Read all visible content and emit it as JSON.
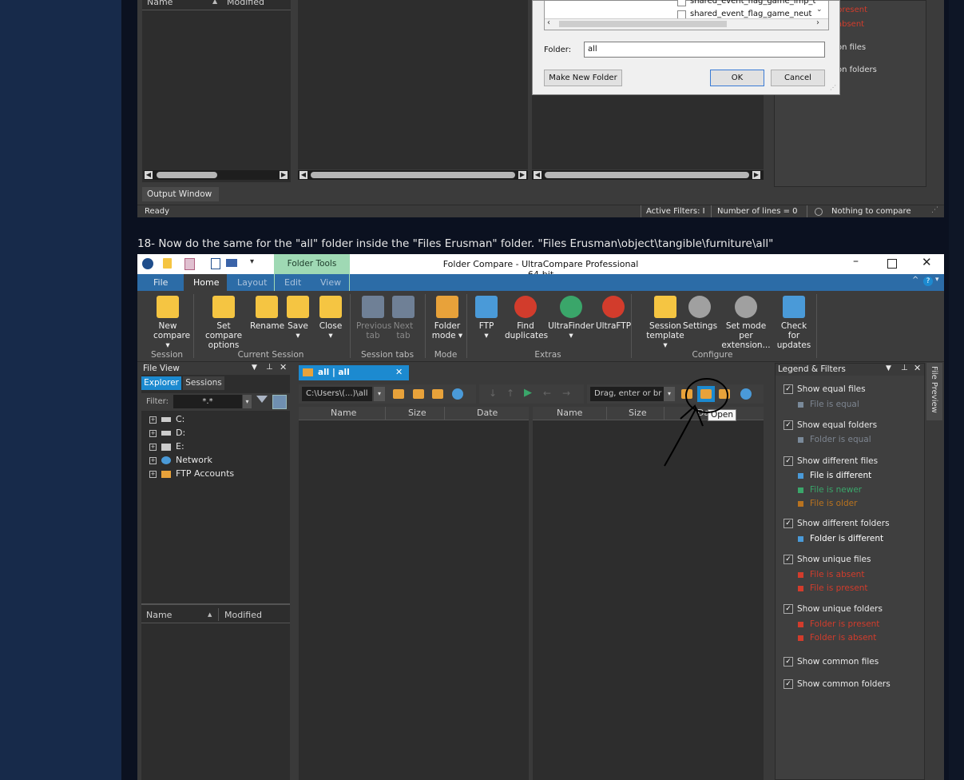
{
  "top_shot": {
    "file_list_headers": {
      "name": "Name",
      "modified": "Modified"
    },
    "output_window_tab": "Output Window",
    "status": {
      "ready": "Ready",
      "active_filters": "Active Filters: I",
      "lines": "Number of lines = 0",
      "compare": "Nothing to compare"
    },
    "dialog": {
      "items": [
        "shared_event_flag_game_imp_t",
        "shared_event_flag_game_neut"
      ],
      "folder_label": "Folder:",
      "folder_value": "all",
      "make_new_folder": "Make New Folder",
      "ok": "OK",
      "cancel": "Cancel"
    },
    "legend_fragments": [
      "present",
      "absent",
      "on files",
      "on folders"
    ]
  },
  "instruction": "18- Now do the same for the \"all\" folder inside the \"Files Erusman\" folder. \"Files Erusman\\object\\tangible\\furniture\\all\"",
  "app": {
    "context_tab": "Folder Tools",
    "title": "Folder Compare - UltraCompare Professional 64-bit",
    "menu": [
      "File",
      "Home",
      "Layout",
      "Edit",
      "View"
    ],
    "ribbon": {
      "buttons": [
        {
          "l1": "New",
          "l2": "compare ▾"
        },
        {
          "l1": "Set compare",
          "l2": "options"
        },
        {
          "l1": "Rename",
          "l2": ""
        },
        {
          "l1": "Save",
          "l2": "▾"
        },
        {
          "l1": "Close",
          "l2": "▾"
        },
        {
          "l1": "Previous",
          "l2": "tab"
        },
        {
          "l1": "Next",
          "l2": "tab"
        },
        {
          "l1": "Folder",
          "l2": "mode ▾"
        },
        {
          "l1": "FTP",
          "l2": "▾"
        },
        {
          "l1": "Find",
          "l2": "duplicates"
        },
        {
          "l1": "UltraFinder",
          "l2": "▾"
        },
        {
          "l1": "UltraFTP",
          "l2": ""
        },
        {
          "l1": "Session",
          "l2": "template ▾"
        },
        {
          "l1": "Settings",
          "l2": ""
        },
        {
          "l1": "Set mode per",
          "l2": "extension..."
        },
        {
          "l1": "Check for",
          "l2": "updates"
        }
      ],
      "groups": [
        "Session",
        "Current Session",
        "Session tabs",
        "Mode",
        "Extras",
        "Configure"
      ]
    },
    "file_view": {
      "title": "File View",
      "tabs": [
        "Explorer",
        "Sessions"
      ],
      "filter_label": "Filter:",
      "filter_value": "*.*",
      "tree": [
        "C:",
        "D:",
        "E:",
        "Network",
        "FTP Accounts"
      ],
      "list_headers": {
        "name": "Name",
        "modified": "Modified"
      }
    },
    "compare": {
      "tab_label": "all | all",
      "left_path": "C:\\Users\\(...)\\all",
      "right_path": "Drag, enter or br",
      "columns_left": [
        "Name",
        "Size",
        "Date"
      ],
      "columns_right": [
        "Name",
        "Size",
        "Da"
      ],
      "tooltip": "Open"
    },
    "legend": {
      "title": "Legend & Filters",
      "side_tab": "File Preview",
      "groups": [
        {
          "label": "Show equal files",
          "items": [
            {
              "text": "File is equal",
              "color": "#7a8a9a"
            }
          ]
        },
        {
          "label": "Show equal folders",
          "items": [
            {
              "text": "Folder is equal",
              "color": "#7a8a9a"
            }
          ]
        },
        {
          "label": "Show different files",
          "items": [
            {
              "text": "File is different",
              "color": "#ffffff"
            },
            {
              "text": "File is newer",
              "color": "#3aa66a"
            },
            {
              "text": "File is older",
              "color": "#b9731f"
            }
          ]
        },
        {
          "label": "Show different folders",
          "items": [
            {
              "text": "Folder is different",
              "color": "#ffffff"
            }
          ]
        },
        {
          "label": "Show unique files",
          "items": [
            {
              "text": "File is absent",
              "color": "#d23c2c"
            },
            {
              "text": "File is present",
              "color": "#d23c2c"
            }
          ]
        },
        {
          "label": "Show unique folders",
          "items": [
            {
              "text": "Folder is present",
              "color": "#d23c2c"
            },
            {
              "text": "Folder is absent",
              "color": "#d23c2c"
            }
          ]
        },
        {
          "label": "Show common files",
          "items": []
        },
        {
          "label": "Show common folders",
          "items": []
        }
      ]
    }
  },
  "colors": {
    "accent": "#2c6ca7",
    "folder_tools": "#9fd9b4",
    "tab_blue": "#1c8ad0",
    "absent_red": "#d23c2c"
  }
}
